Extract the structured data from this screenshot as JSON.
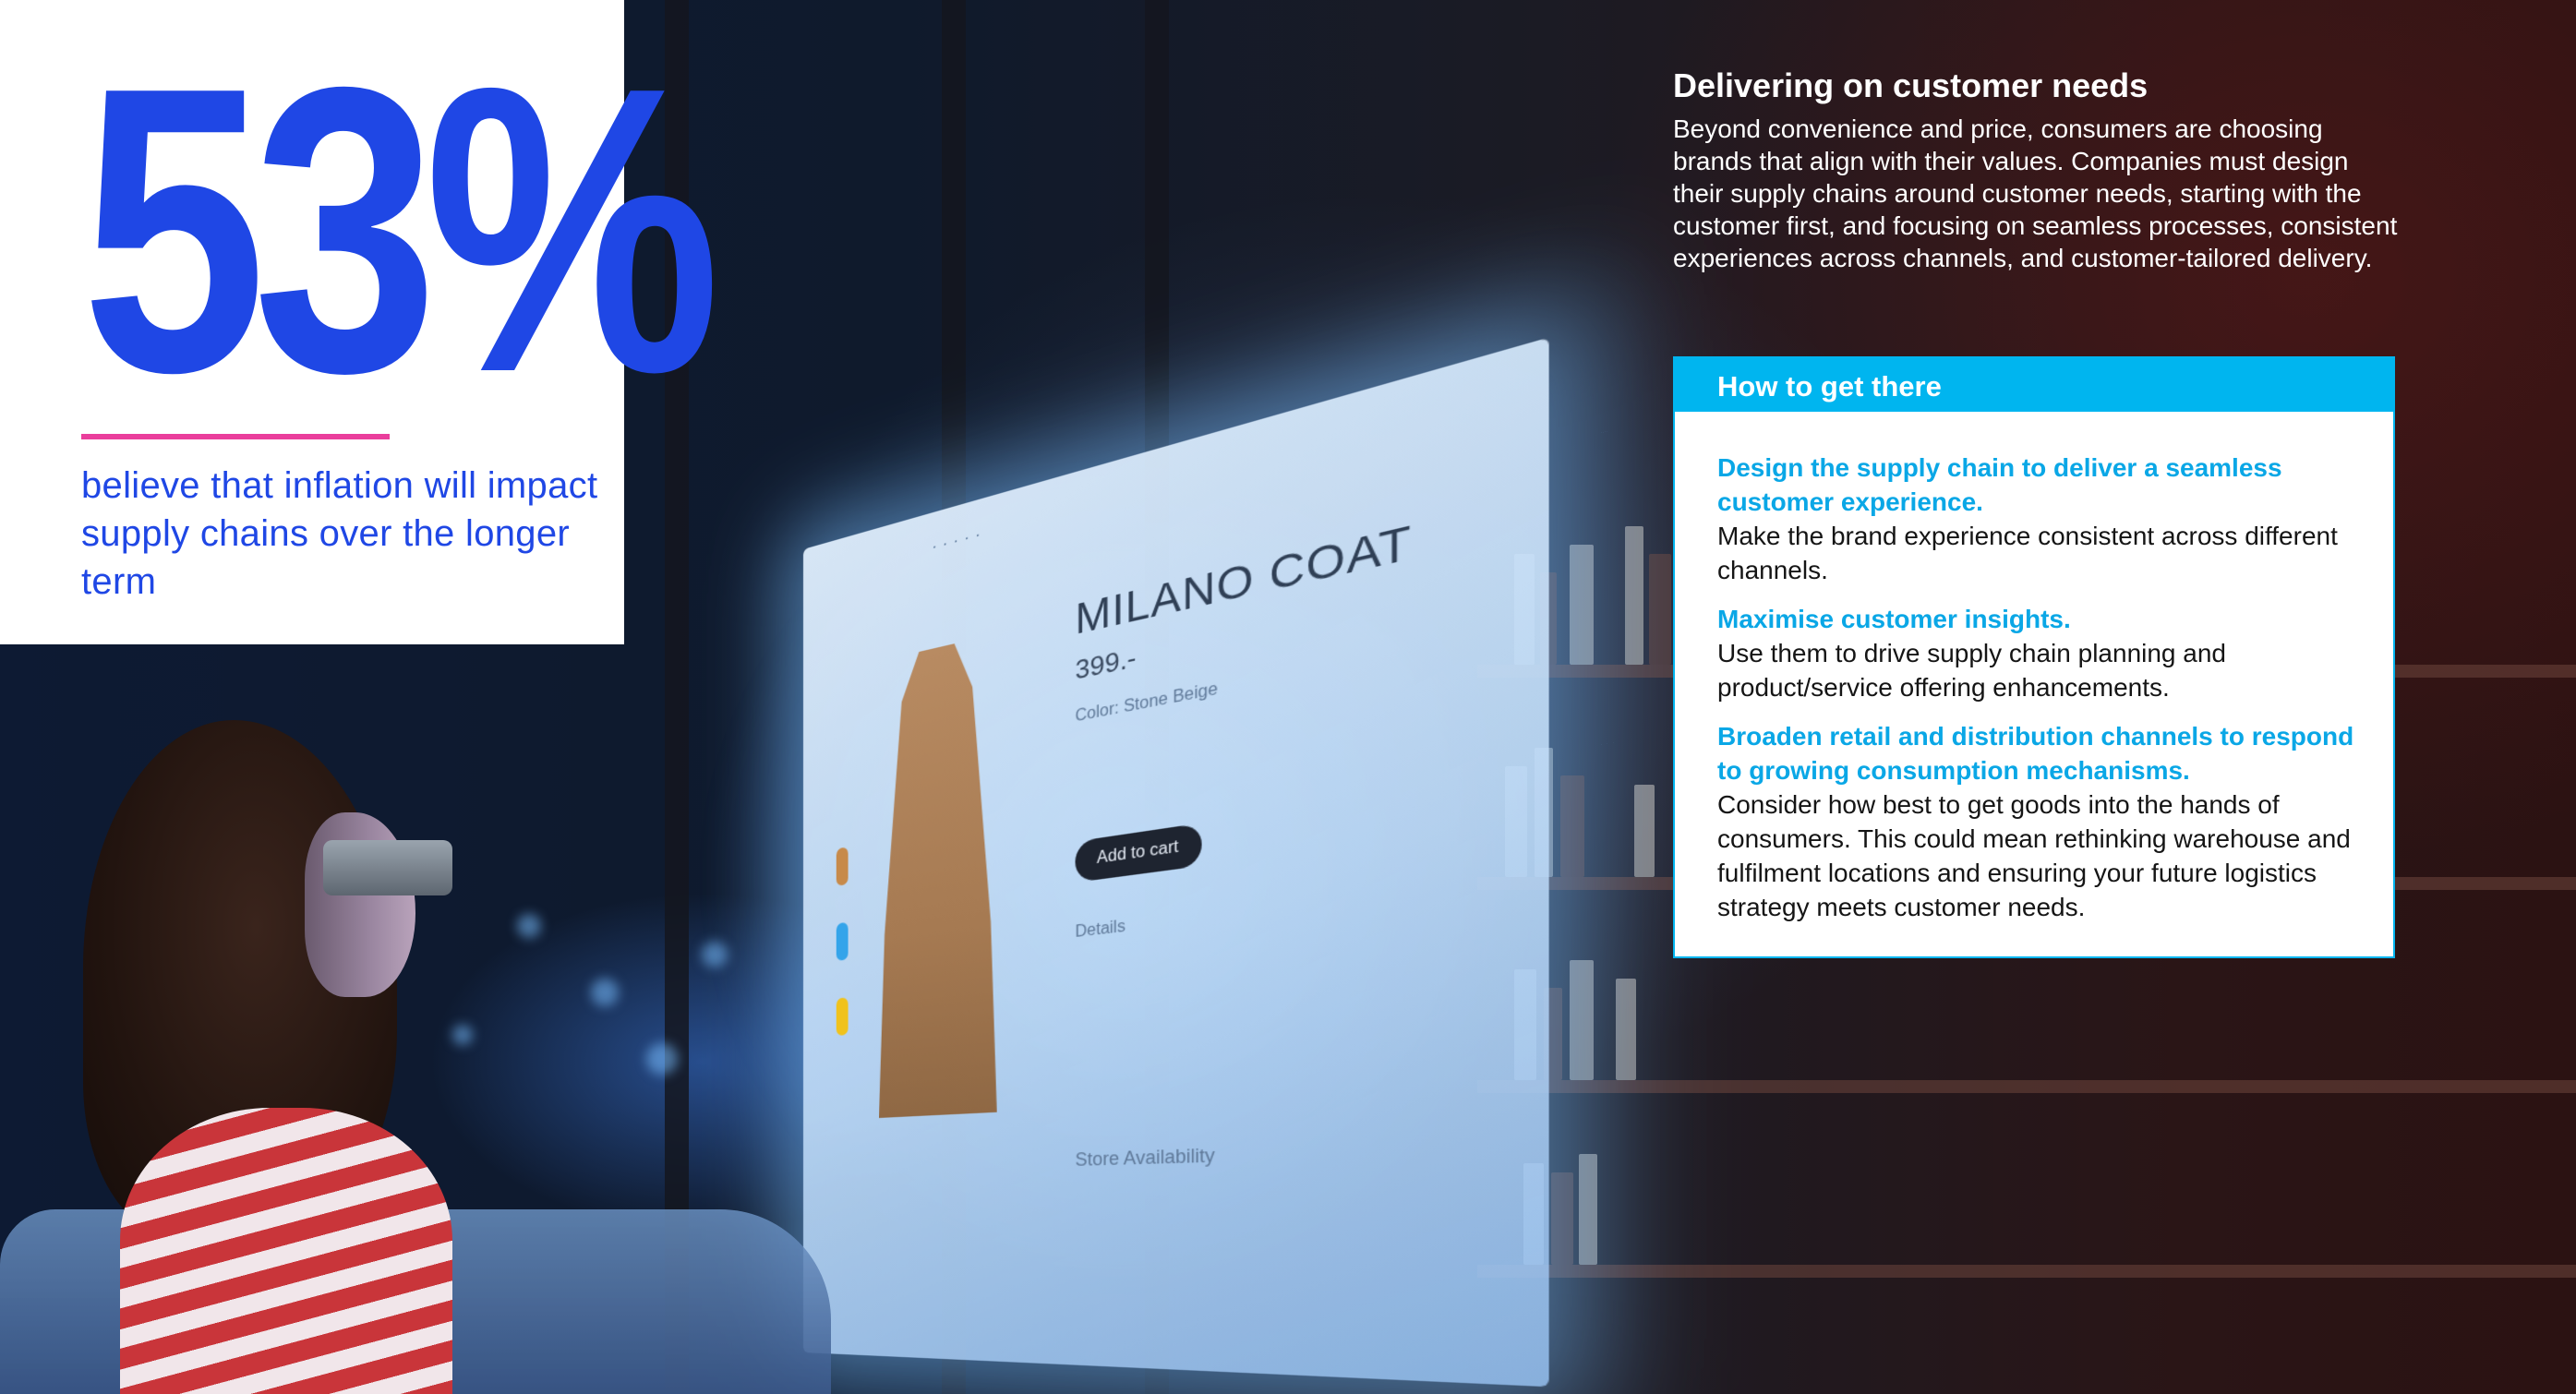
{
  "stat": {
    "value": "53%",
    "caption": "believe that inflation will impact supply chains over the longer term"
  },
  "section": {
    "heading": "Delivering on customer needs",
    "body": "Beyond convenience and price, consumers are choosing brands that align with their values. Companies must design their supply chains around customer needs, starting with the customer first, and focusing on seamless processes, consistent experiences across channels, and customer-tailored delivery."
  },
  "callout": {
    "title": "How to get there",
    "items": [
      {
        "heading": "Design the supply chain to deliver a seamless customer experience.",
        "text": "Make the brand experience consistent across different channels."
      },
      {
        "heading": "Maximise customer insights.",
        "text": "Use them to drive supply chain planning and product/service offering enhancements."
      },
      {
        "heading": "Broaden retail and distribution channels to respond to growing consumption mechanisms.",
        "text": "Consider how best to get goods into the hands of consumers. This could mean rethinking warehouse and fulfilment locations and ensuring your future logistics strategy meets customer needs."
      }
    ]
  },
  "photo": {
    "product_name": "MILANO COAT",
    "product_price": "399.-",
    "product_color": "Color: Stone Beige",
    "add_to_cart": "Add to cart",
    "details": "Details",
    "store_availability": "Store Availability"
  },
  "colors": {
    "stat_blue": "#1f47e5",
    "rule_pink": "#ea3e9c",
    "callout_cyan": "#00b5ef",
    "callout_heading": "#0aa7e6"
  }
}
